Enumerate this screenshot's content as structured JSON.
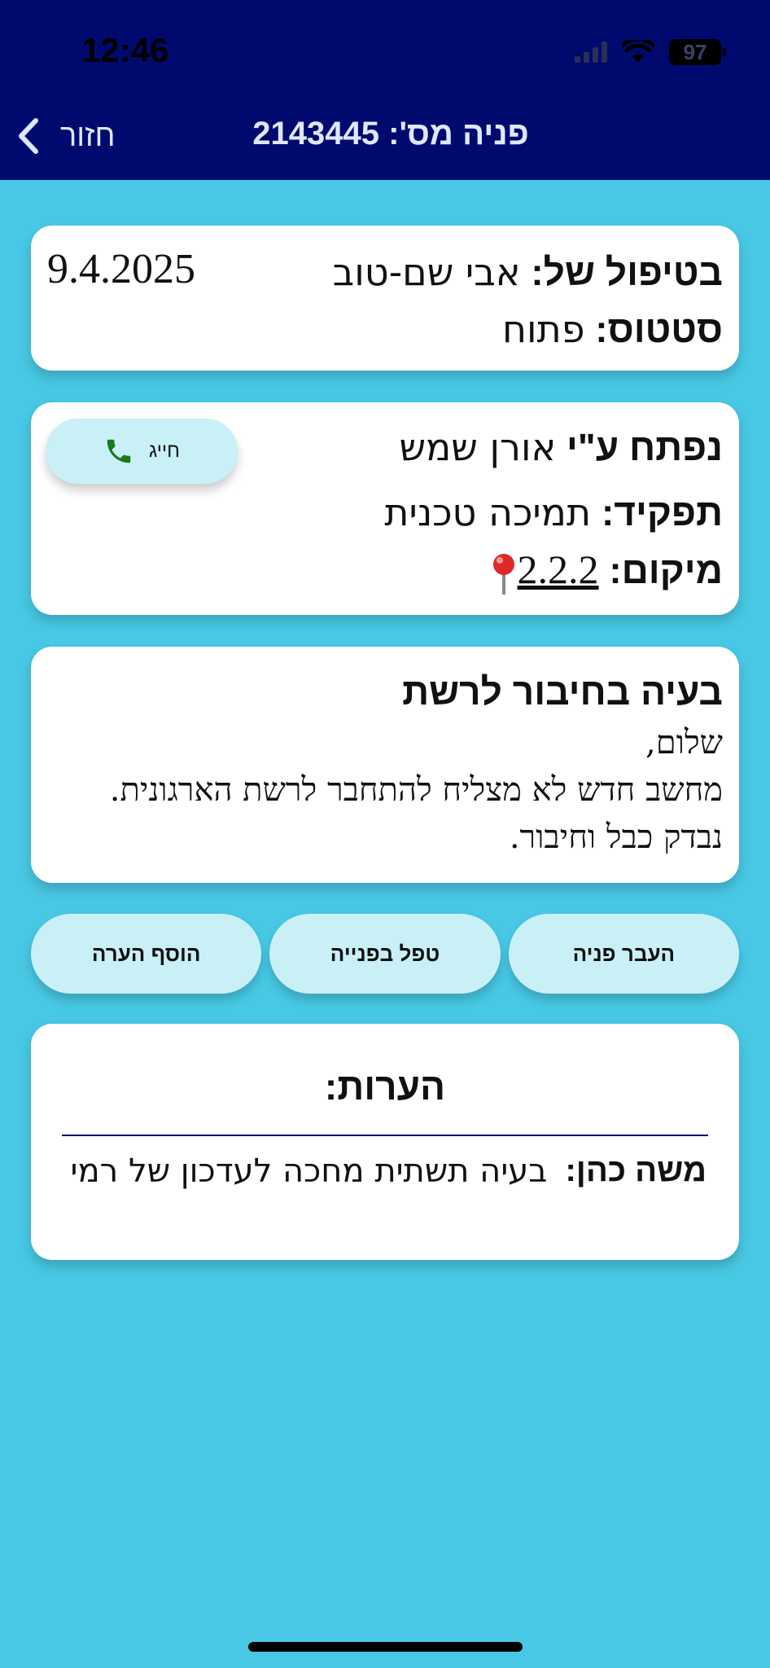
{
  "status_bar": {
    "time": "12:46",
    "battery": "97"
  },
  "header": {
    "back_label": "חזור",
    "title": "פניה מס': 2143445"
  },
  "assignment": {
    "handler_label": "בטיפול של:",
    "handler_name": "אבי שם-טוב",
    "status_label": "סטטוס:",
    "status_value": "פתוח",
    "date": "9.4.2025"
  },
  "opener": {
    "opened_by_label": "נפתח ע\"י",
    "opened_by_name": "אורן שמש",
    "role_label": "תפקיד:",
    "role_value": "תמיכה טכנית",
    "location_label": "מיקום:",
    "location_value": "2.2.2",
    "call_button_label": "חייג",
    "call_icon_color": "#1a7a1a"
  },
  "ticket": {
    "subject": "בעיה בחיבור לרשת",
    "body_lines": [
      "שלום,",
      "מחשב חדש לא מצליח להתחבר לרשת הארגונית.",
      "נבדק כבל וחיבור."
    ]
  },
  "actions": {
    "transfer": "העבר פניה",
    "handle": "טפל בפנייה",
    "add_note": "הוסף הערה"
  },
  "notes": {
    "title": "הערות:",
    "items": [
      {
        "author": "משה כהן:",
        "text": "בעיה תשתית מחכה לעדכון של רמי"
      }
    ]
  },
  "colors": {
    "header_bg": "#000a6e",
    "page_bg": "#48c8e4",
    "button_bg": "#c8f0f6"
  }
}
